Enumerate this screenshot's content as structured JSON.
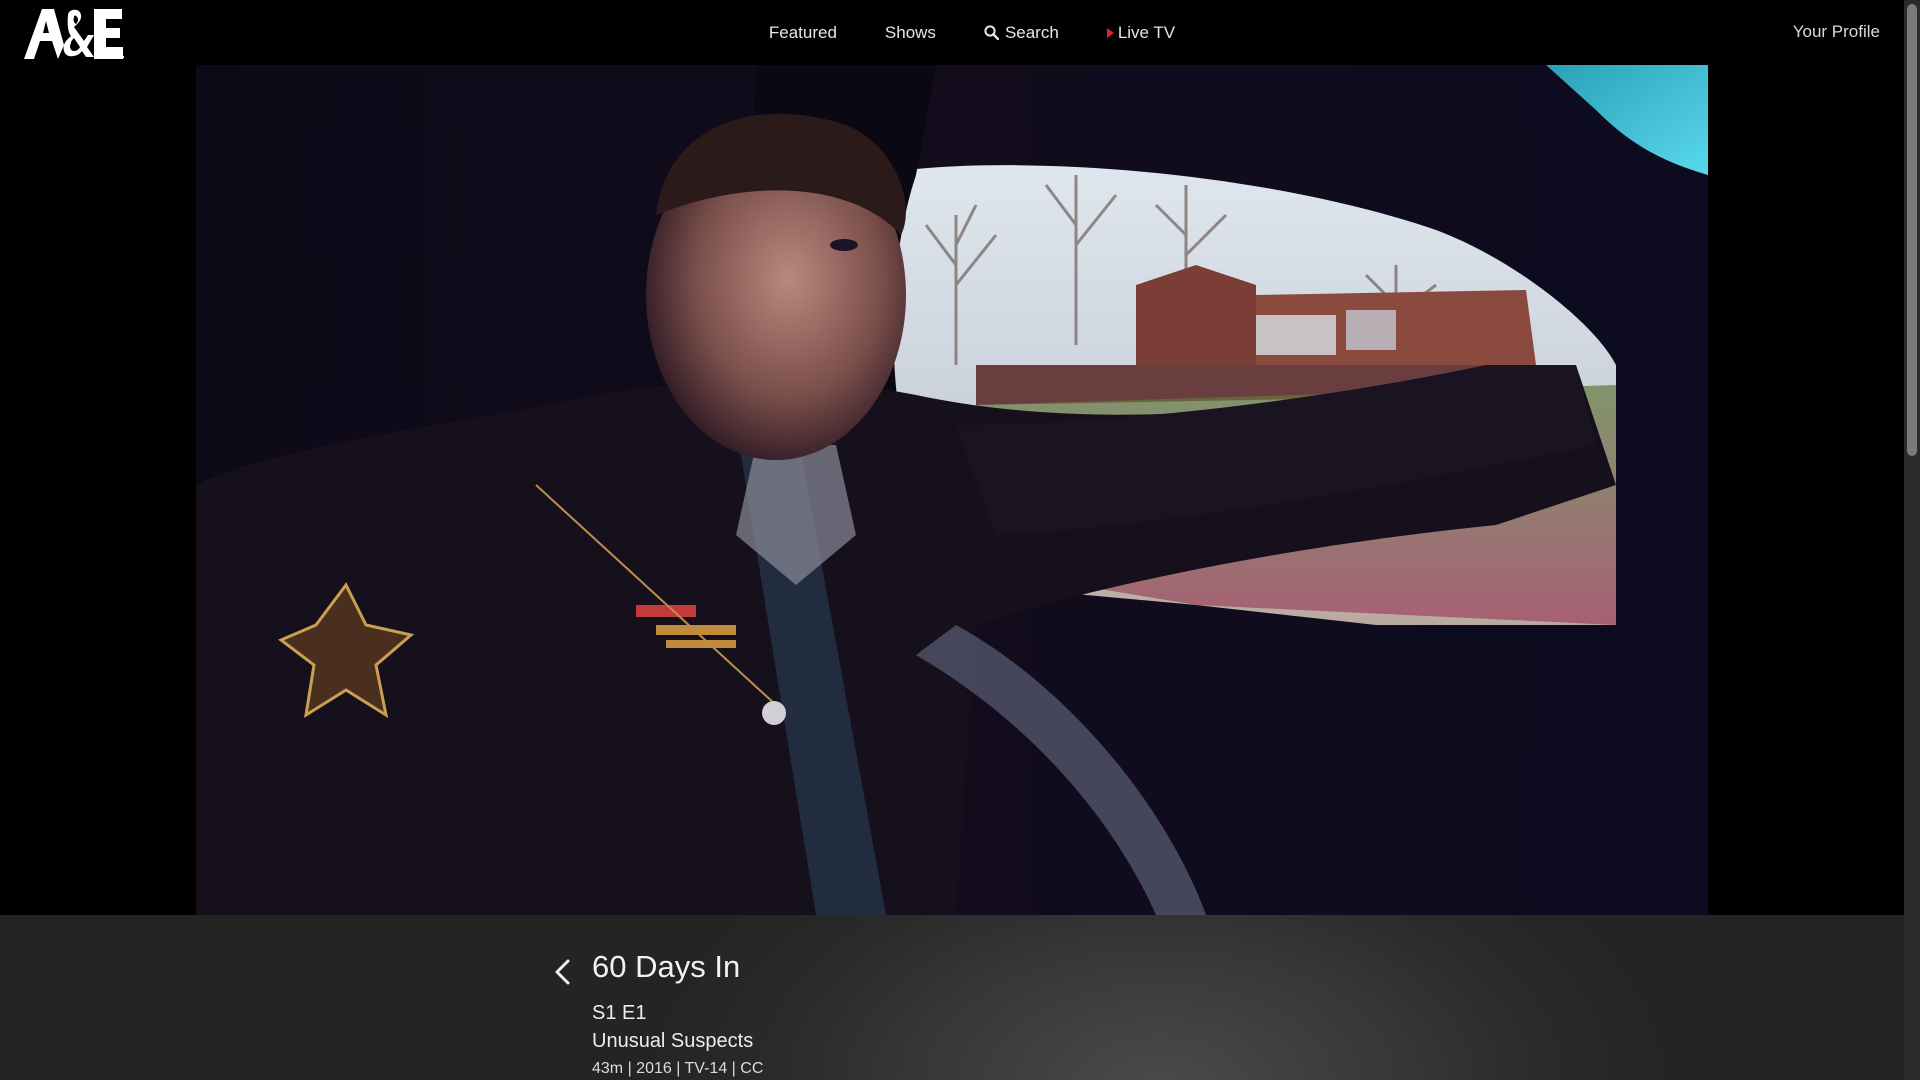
{
  "brand": {
    "logo_text": "A&E"
  },
  "nav": {
    "items": [
      {
        "label": "Featured",
        "icon": ""
      },
      {
        "label": "Shows",
        "icon": ""
      },
      {
        "label": "Search",
        "icon": "search-icon"
      },
      {
        "label": "Live TV",
        "icon": "live-play-icon"
      }
    ],
    "profile_label": "Your Profile",
    "live_color": "#e0212b"
  },
  "video": {
    "description_icon": "video-frame"
  },
  "episode": {
    "show_title": "60 Days In",
    "episode_number": "S1 E1",
    "episode_title": "Unusual Suspects",
    "meta": "43m | 2016 | TV-14 | CC"
  }
}
